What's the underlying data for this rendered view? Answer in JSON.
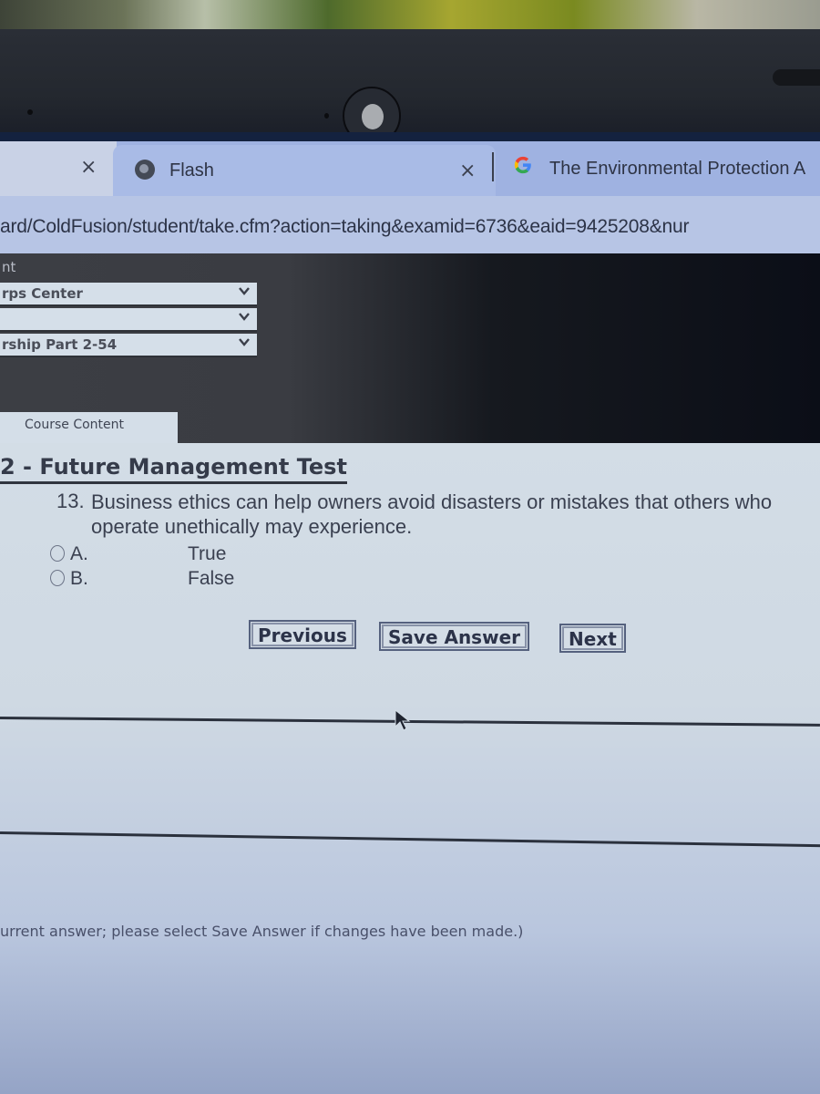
{
  "browser": {
    "tabs": [
      {
        "label": "",
        "close_icon": "×"
      },
      {
        "label": "Flash",
        "favicon": "globe-icon",
        "close_icon": "×",
        "active": true
      },
      {
        "label": "The Environmental Protection A",
        "favicon": "google-g-icon"
      }
    ],
    "url": "ard/ColdFusion/student/take.cfm?action=taking&examid=6736&eaid=9425208&nur"
  },
  "header": {
    "fragment": "nt",
    "dropdowns": [
      {
        "selected": "rps Center"
      },
      {
        "selected": ""
      },
      {
        "selected": "rship Part 2-54"
      }
    ],
    "tab_label": "Course Content"
  },
  "exam": {
    "title": "2 - Future Management Test",
    "question": {
      "number": "13.",
      "text": "Business ethics can help owners avoid disasters or mistakes that others who operate unethically may experience.",
      "options": [
        {
          "letter": "A.",
          "text": "True",
          "selected": false
        },
        {
          "letter": "B.",
          "text": "False",
          "selected": false
        }
      ]
    },
    "buttons": {
      "previous": "Previous",
      "save": "Save Answer",
      "next": "Next"
    },
    "footer_note": "urrent answer; please select Save Answer if changes have been made.)"
  },
  "colors": {
    "content_bg": "#d3dde6",
    "tabstrip_bg": "#9fb2e1",
    "button_border": "#55617e",
    "text": "#3a4050"
  }
}
